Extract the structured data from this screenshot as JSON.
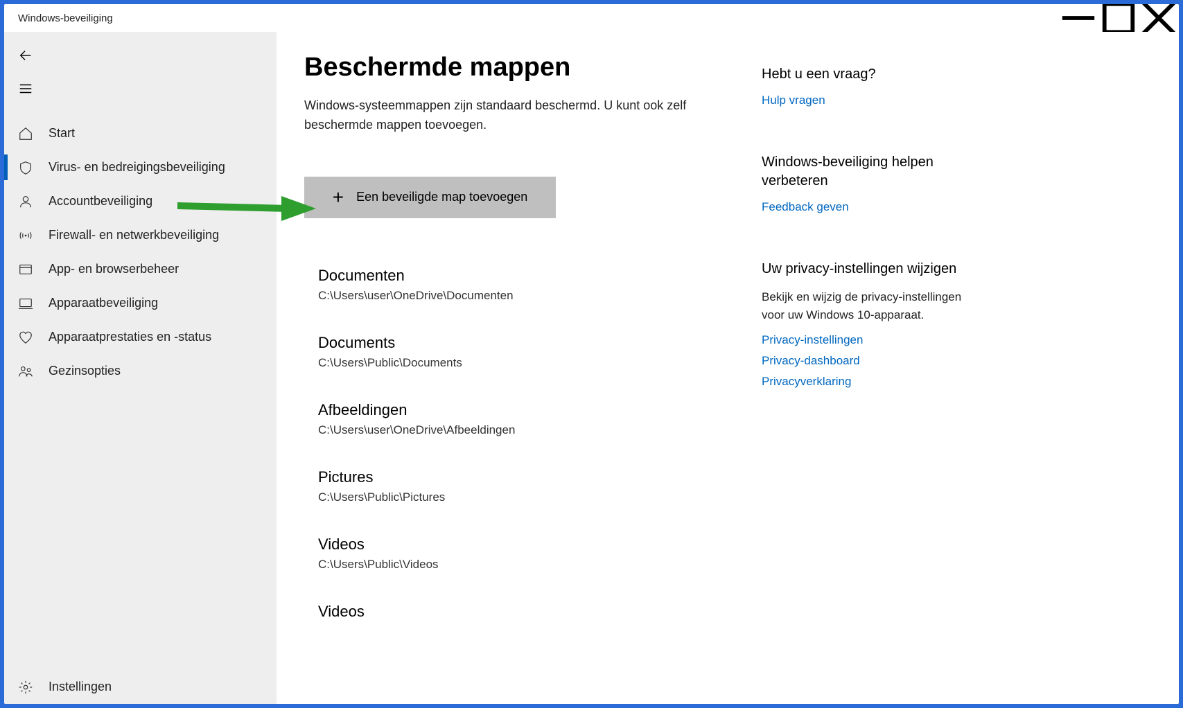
{
  "window": {
    "title": "Windows-beveiliging"
  },
  "nav": {
    "back": "←",
    "menu": "≡",
    "items": [
      {
        "label": "Start"
      },
      {
        "label": "Virus- en bedreigingsbeveiliging"
      },
      {
        "label": "Accountbeveiliging"
      },
      {
        "label": "Firewall- en netwerkbeveiliging"
      },
      {
        "label": "App- en browserbeheer"
      },
      {
        "label": "Apparaatbeveiliging"
      },
      {
        "label": "Apparaatprestaties en -status"
      },
      {
        "label": "Gezinsopties"
      }
    ],
    "settings_label": "Instellingen"
  },
  "main": {
    "title": "Beschermde mappen",
    "description": "Windows-systeemmappen zijn standaard beschermd. U kunt ook zelf beschermde mappen toevoegen.",
    "add_button": "Een beveiligde map toevoegen",
    "folders": [
      {
        "name": "Documenten",
        "path": "C:\\Users\\user\\OneDrive\\Documenten"
      },
      {
        "name": "Documents",
        "path": "C:\\Users\\Public\\Documents"
      },
      {
        "name": "Afbeeldingen",
        "path": "C:\\Users\\user\\OneDrive\\Afbeeldingen"
      },
      {
        "name": "Pictures",
        "path": "C:\\Users\\Public\\Pictures"
      },
      {
        "name": "Videos",
        "path": "C:\\Users\\Public\\Videos"
      },
      {
        "name": "Videos",
        "path": ""
      }
    ]
  },
  "aside": {
    "help_title": "Hebt u een vraag?",
    "help_link": "Hulp vragen",
    "improve_title": "Windows-beveiliging helpen verbeteren",
    "feedback_link": "Feedback geven",
    "privacy_title": "Uw privacy-instellingen wijzigen",
    "privacy_text": "Bekijk en wijzig de privacy-instellingen voor uw Windows 10-apparaat.",
    "privacy_links": [
      "Privacy-instellingen",
      "Privacy-dashboard",
      "Privacyverklaring"
    ]
  },
  "colors": {
    "accent": "#005fb8",
    "link": "#0067c0",
    "arrow": "#2e9e2e",
    "frame": "#2a6bd8"
  }
}
